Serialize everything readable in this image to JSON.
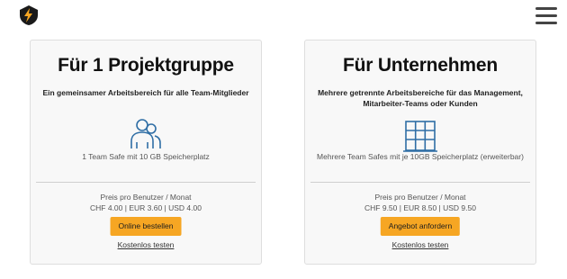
{
  "header": {
    "logo_icon": "shield-bolt-icon",
    "menu_icon": "hamburger-menu-icon",
    "accent_color": "#f6a623"
  },
  "cards": [
    {
      "title": "Für 1 Projektgruppe",
      "subtitle": "Ein gemeinsamer Arbeitsbereich für alle Team-Mitglieder",
      "icon": "team-icon",
      "feature": "1 Team Safe mit 10 GB Speicherplatz",
      "price_label": "Preis pro Benutzer / Monat",
      "price_value": "CHF 4.00 | EUR 3.60 | USD 4.00",
      "cta_label": "Online bestellen",
      "trial_label": "Kostenlos testen"
    },
    {
      "title": "Für Unternehmen",
      "subtitle": "Mehrere getrennte Arbeitsbereiche für das Management, Mitarbeiter-Teams oder Kunden",
      "icon": "building-icon",
      "feature": "Mehrere Team Safes mit je 10GB Speicherplatz (erweiterbar)",
      "price_label": "Preis pro Benutzer / Monat",
      "price_value": "CHF 9.50 | EUR 8.50 | USD 9.50",
      "cta_label": "Angebot anfordern",
      "trial_label": "Kostenlos testen"
    }
  ]
}
